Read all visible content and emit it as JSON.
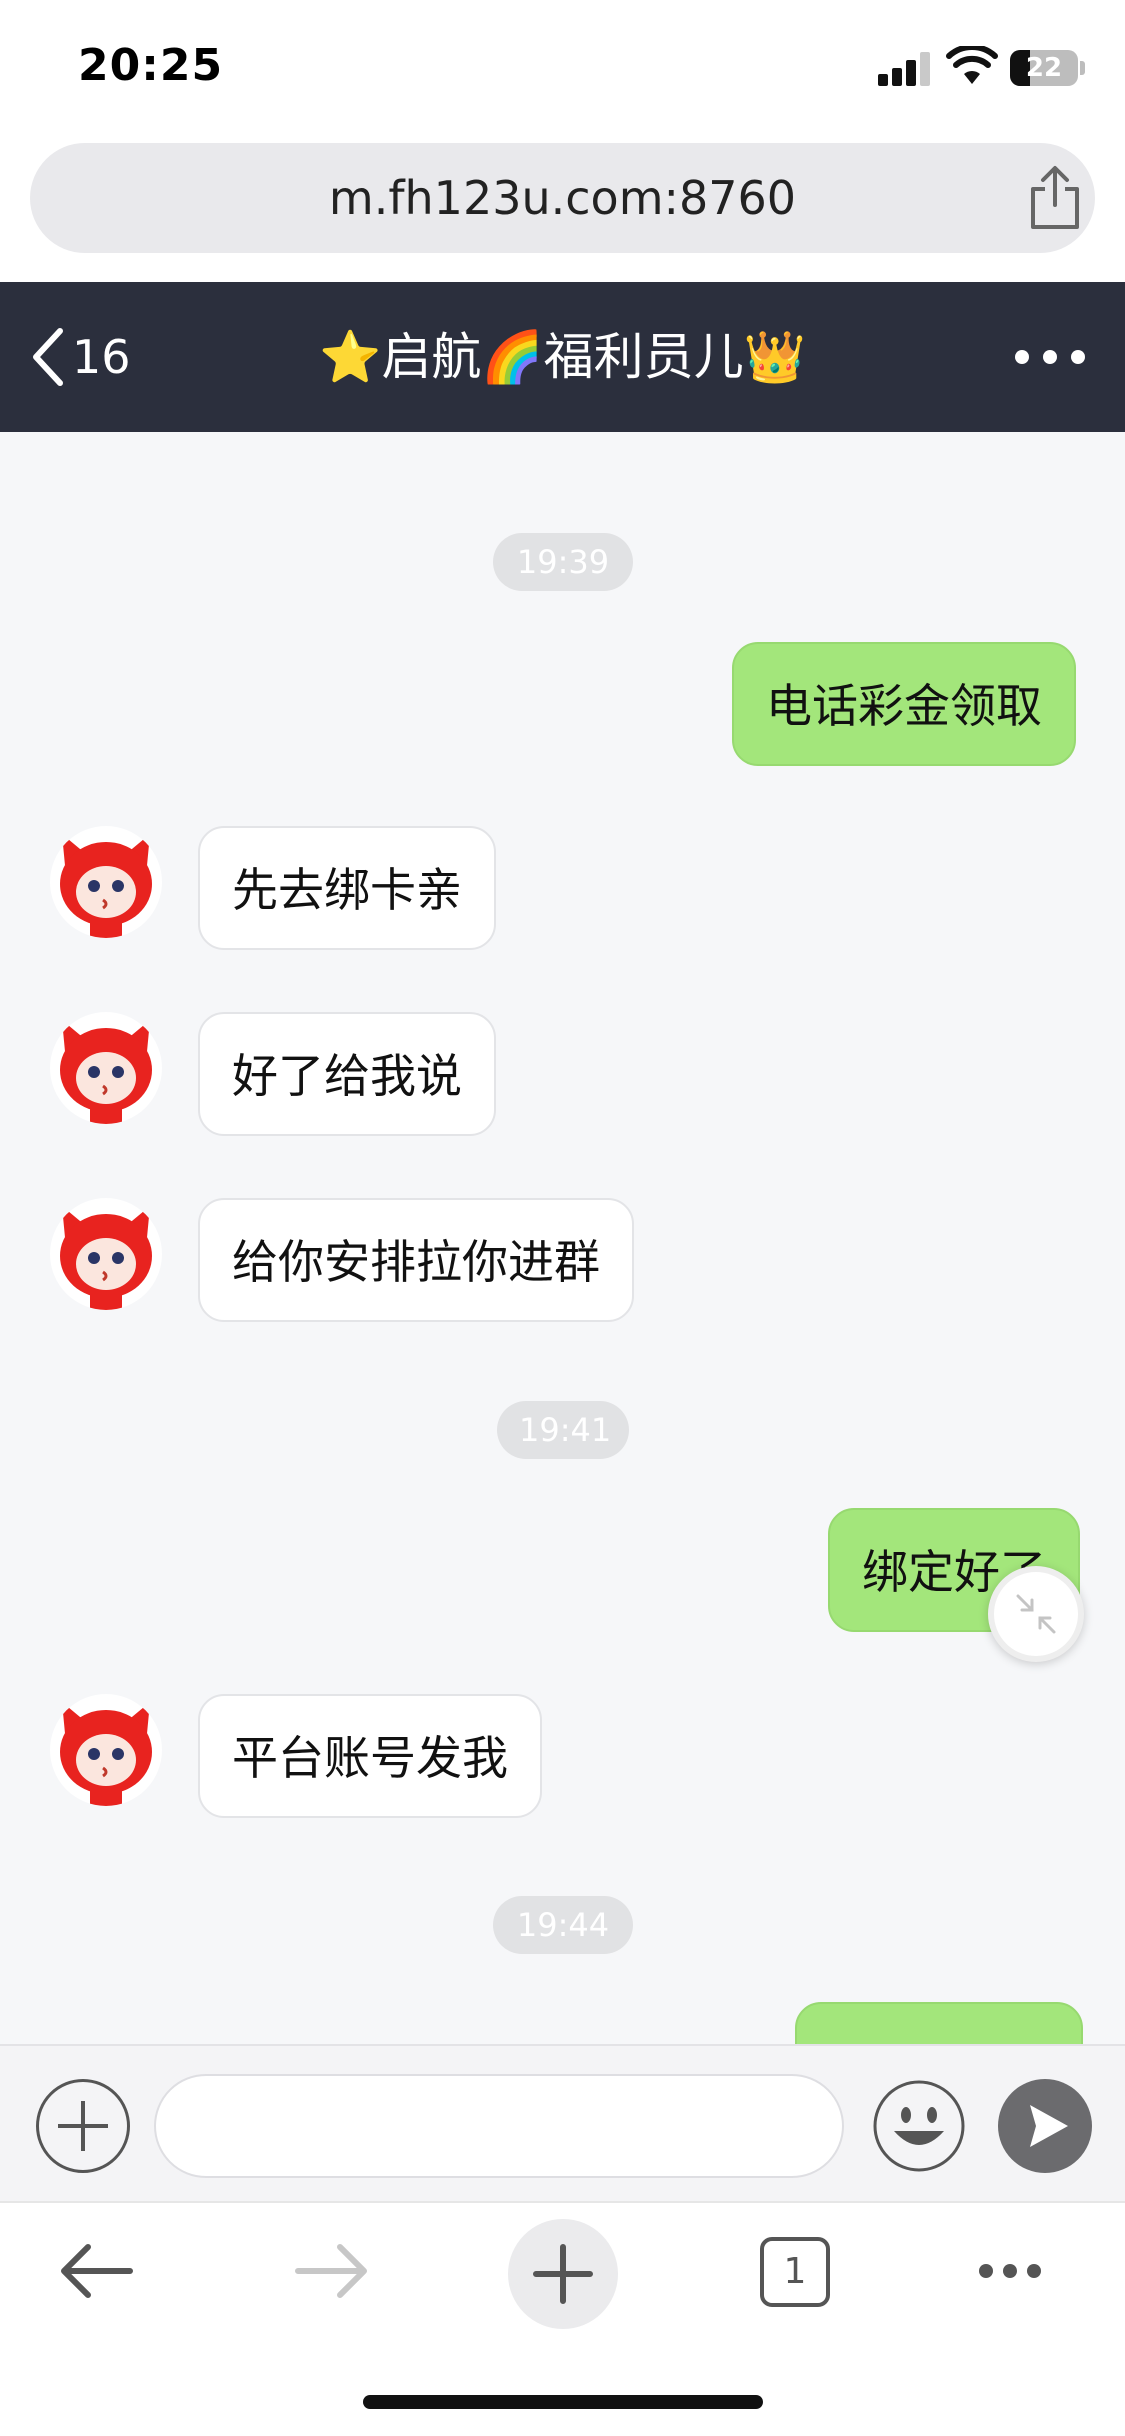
{
  "status_bar": {
    "time": "20:25",
    "battery": "22"
  },
  "browser": {
    "url": "m.fh123u.com:8760",
    "tab_count": "1"
  },
  "chat_header": {
    "back_count": "16",
    "title": "⭐启航🌈福利员儿👑"
  },
  "messages": [
    {
      "type": "time",
      "text": "19:39"
    },
    {
      "type": "out",
      "text": "电话彩金领取"
    },
    {
      "type": "in",
      "text": "先去绑卡亲"
    },
    {
      "type": "in",
      "text": "好了给我说"
    },
    {
      "type": "in",
      "text": "给你安排拉你进群"
    },
    {
      "type": "time",
      "text": "19:41"
    },
    {
      "type": "out",
      "text": "绑定好了"
    },
    {
      "type": "in",
      "text": "平台账号发我"
    },
    {
      "type": "time",
      "text": "19:44"
    }
  ],
  "input": {
    "value": "",
    "placeholder": ""
  },
  "icons": {
    "share": "share-icon",
    "back": "chevron-left-icon",
    "more": "more-icon",
    "plus": "plus-icon",
    "emoji": "smiley-icon",
    "send": "send-icon",
    "nav_back": "arrow-left-icon",
    "nav_forward": "arrow-right-icon",
    "new_tab": "plus-icon",
    "menu": "more-icon",
    "minimize": "minimize-icon"
  },
  "colors": {
    "header_bg": "#2b2f3d",
    "bubble_out": "#a3e67b",
    "bubble_in": "#ffffff",
    "chat_bg": "#f6f7f9"
  }
}
